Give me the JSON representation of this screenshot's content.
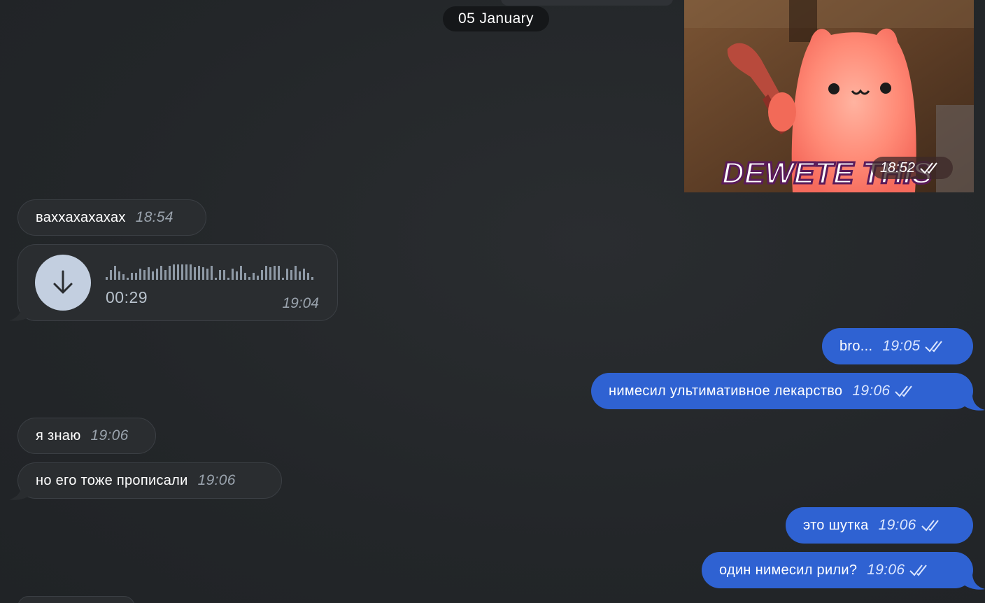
{
  "date_separator": "05 January",
  "media": {
    "caption": "DEWETE THIS",
    "time": "18:52"
  },
  "messages": [
    {
      "side": "in",
      "text": "ваххахахахах",
      "time": "18:54"
    },
    {
      "side": "in",
      "type": "voice",
      "duration": "00:29",
      "time": "19:04"
    },
    {
      "side": "out",
      "text": "bro...",
      "time": "19:05",
      "status": "read"
    },
    {
      "side": "out",
      "text": "нимесил ультимативное лекарство",
      "time": "19:06",
      "status": "read"
    },
    {
      "side": "in",
      "text": "я знаю",
      "time": "19:06"
    },
    {
      "side": "in",
      "text": "но его тоже прописали",
      "time": "19:06"
    },
    {
      "side": "out",
      "text": "это шутка",
      "time": "19:06",
      "status": "read"
    },
    {
      "side": "out",
      "text": "один нимесил рили?",
      "time": "19:06",
      "status": "read"
    }
  ],
  "colors": {
    "background": "#24272a",
    "incoming_bubble": "#2a2d30",
    "outgoing_bubble": "#2f62d2",
    "date_pill": "#151719"
  },
  "icons": {
    "download": "download-arrow-icon",
    "read_status": "double-check-icon"
  }
}
